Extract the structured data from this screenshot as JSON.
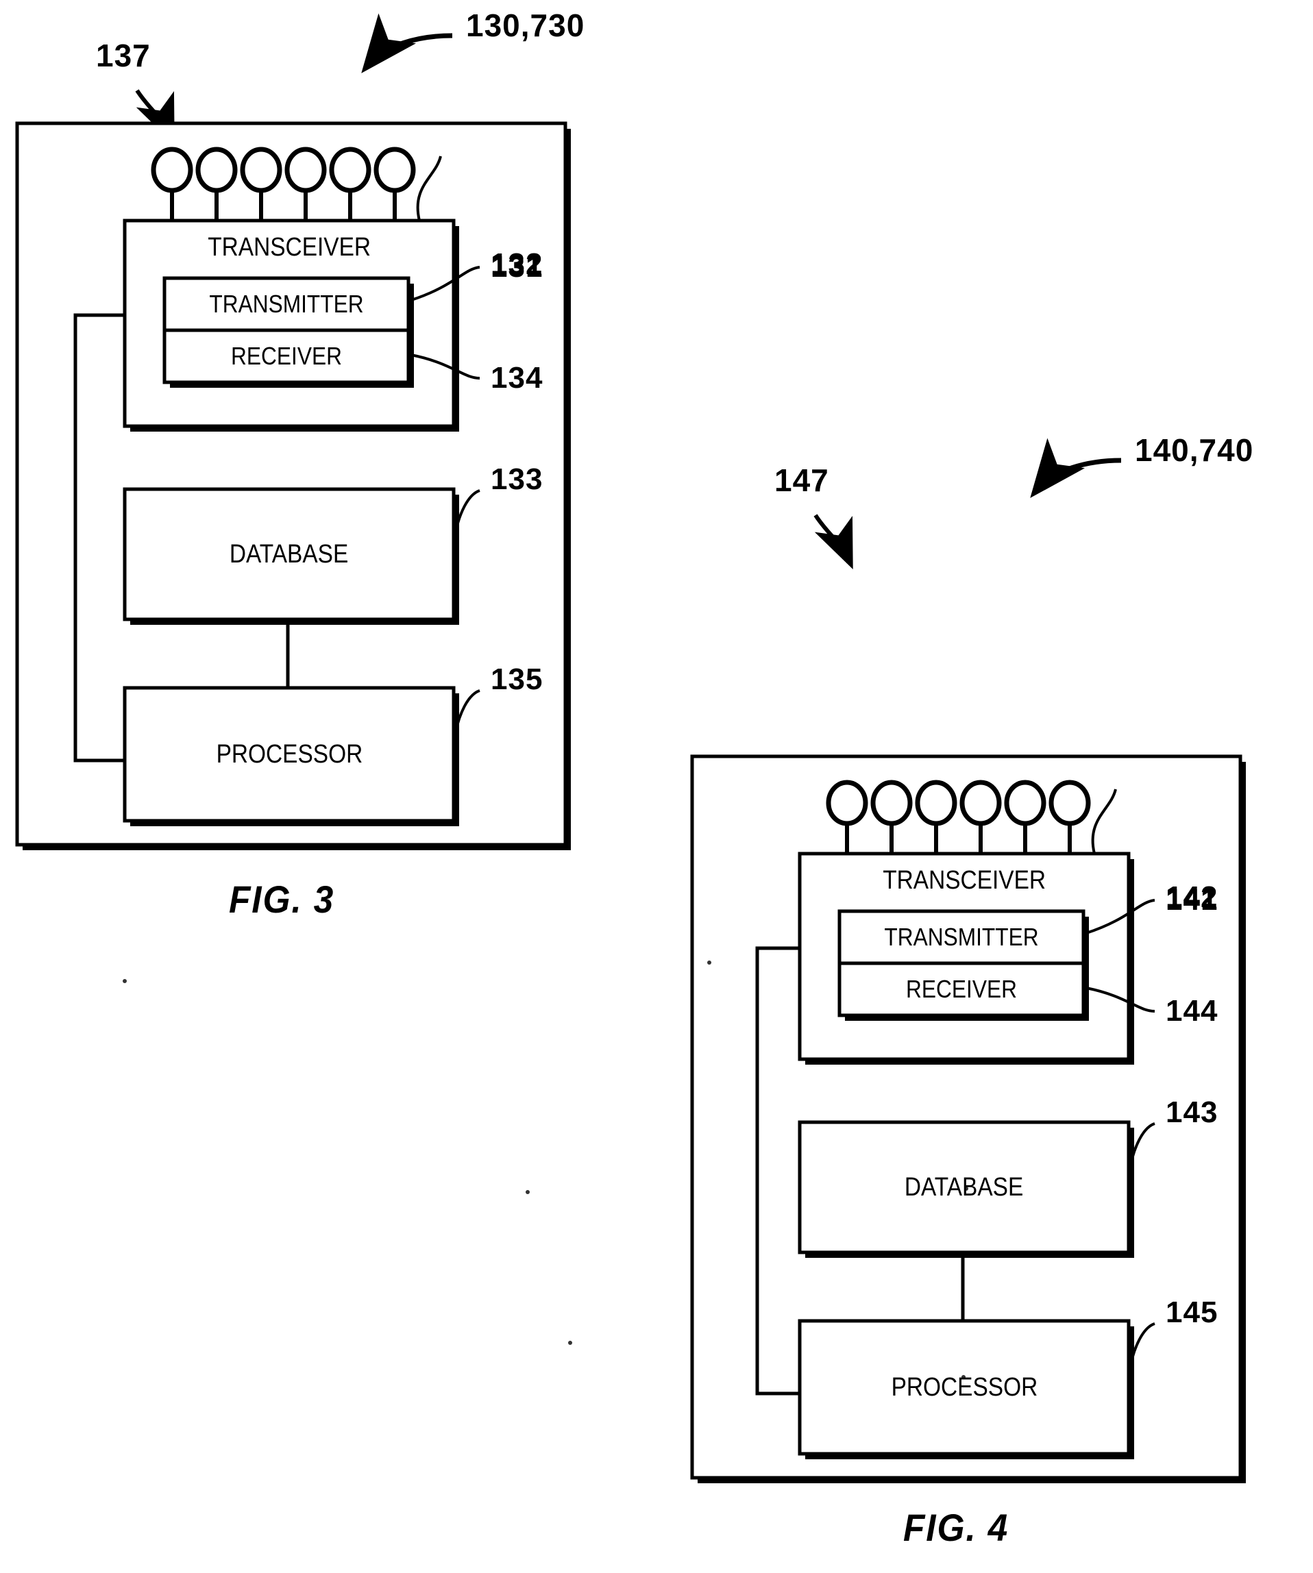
{
  "document": {
    "type": "patent-drawing-sheet",
    "figure_count": 2
  },
  "figures": [
    {
      "id": "fig3",
      "caption": "FIG. 3",
      "assembly_ref": "130,730",
      "antenna_ref": "137",
      "antenna_count": 6,
      "blocks": [
        {
          "name": "transceiver",
          "label": "TRANSCEIVER",
          "ref": "131"
        },
        {
          "name": "transmitter",
          "label": "TRANSMITTER",
          "ref": "132"
        },
        {
          "name": "receiver",
          "label": "RECEIVER",
          "ref": "134"
        },
        {
          "name": "database",
          "label": "DATABASE",
          "ref": "133"
        },
        {
          "name": "processor",
          "label": "PROCESSOR",
          "ref": "135"
        }
      ]
    },
    {
      "id": "fig4",
      "caption": "FIG. 4",
      "assembly_ref": "140,740",
      "antenna_ref": "147",
      "antenna_count": 6,
      "blocks": [
        {
          "name": "transceiver",
          "label": "TRANSCEIVER",
          "ref": "141"
        },
        {
          "name": "transmitter",
          "label": "TRANSMITTER",
          "ref": "142"
        },
        {
          "name": "receiver",
          "label": "RECEIVER",
          "ref": "144"
        },
        {
          "name": "database",
          "label": "DATABASE",
          "ref": "143"
        },
        {
          "name": "processor",
          "label": "PROCESSOR",
          "ref": "145"
        }
      ]
    }
  ],
  "colors": {
    "ink": "#000000",
    "paper": "#ffffff"
  }
}
